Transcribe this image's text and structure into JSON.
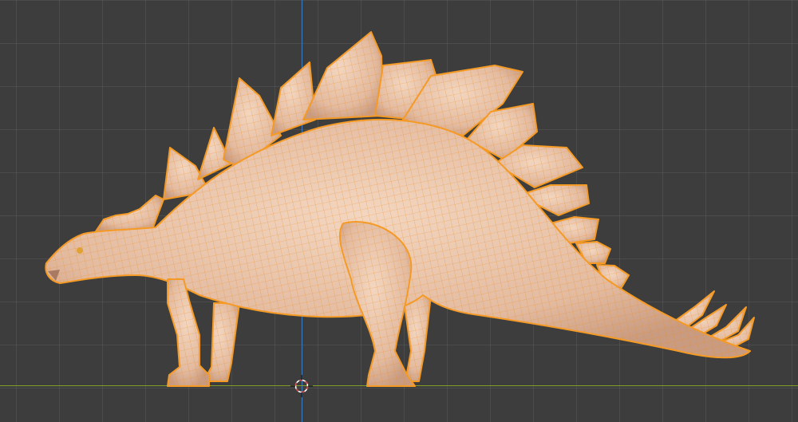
{
  "viewport": {
    "background": "#3d3d3d",
    "axis_colors": {
      "z_axis": "#3c7dbf",
      "y_axis": "#7f9e2a"
    }
  },
  "model": {
    "surface_color": "#e9c6ac",
    "wire_color": "#f08a1c",
    "outline_color": "#f59b25",
    "shading_dark": "#c89a80"
  },
  "cursor": {
    "icon": "3d-cursor-icon"
  }
}
